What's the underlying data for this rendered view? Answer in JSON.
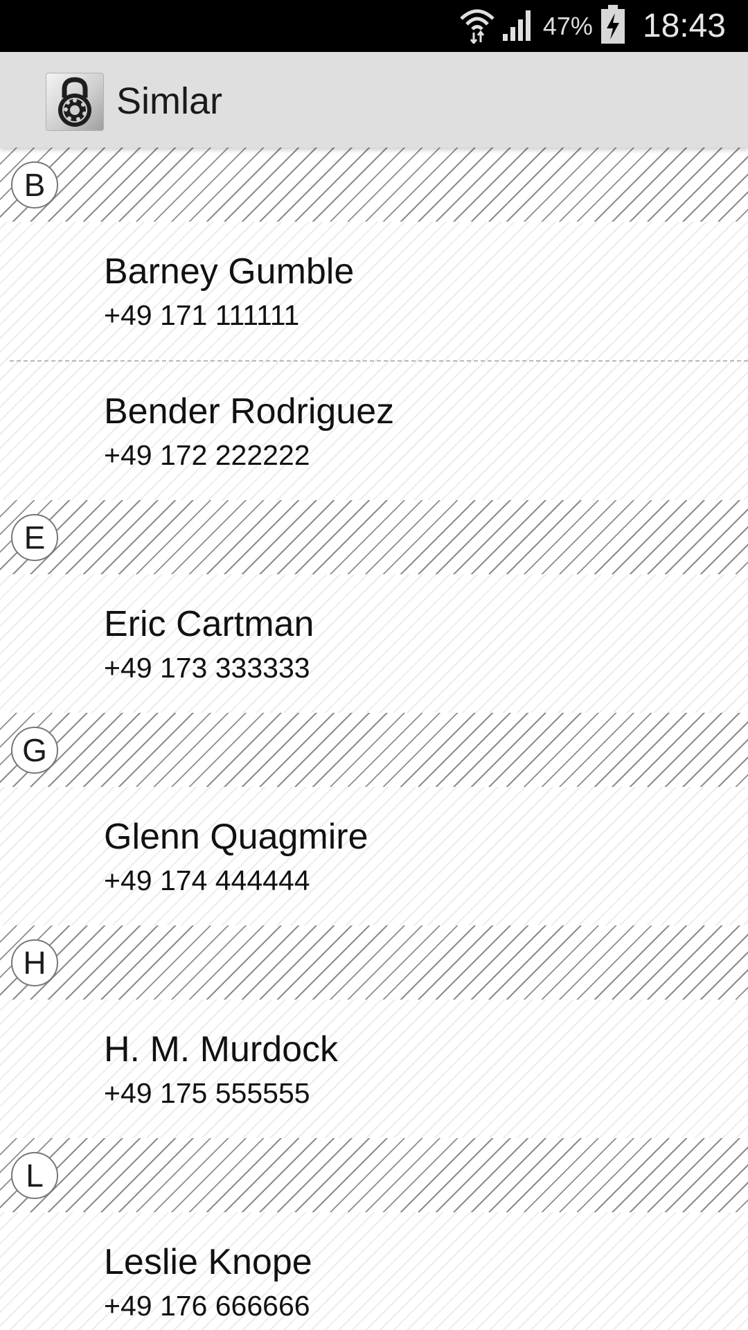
{
  "status_bar": {
    "battery_percent": "47%",
    "time": "18:43",
    "icons": [
      "wifi-icon",
      "signal-icon",
      "battery-charging-icon"
    ]
  },
  "action_bar": {
    "app_icon": "lock-dial-icon",
    "title": "Simlar"
  },
  "sections": [
    {
      "letter": "B",
      "contacts": [
        {
          "name": "Barney Gumble",
          "number": "+49 171 111111"
        },
        {
          "name": "Bender Rodriguez",
          "number": "+49 172 222222"
        }
      ]
    },
    {
      "letter": "E",
      "contacts": [
        {
          "name": "Eric Cartman",
          "number": "+49 173 333333"
        }
      ]
    },
    {
      "letter": "G",
      "contacts": [
        {
          "name": "Glenn Quagmire",
          "number": "+49 174 444444"
        }
      ]
    },
    {
      "letter": "H",
      "contacts": [
        {
          "name": "H. M. Murdock",
          "number": "+49 175 555555"
        }
      ]
    },
    {
      "letter": "L",
      "contacts": [
        {
          "name": "Leslie Knope",
          "number": "+49 176 666666"
        }
      ]
    }
  ]
}
